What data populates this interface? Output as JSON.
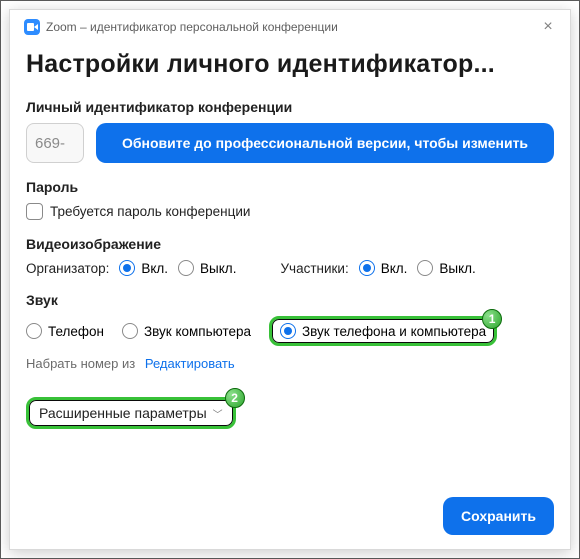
{
  "window": {
    "title": "Zoom – идентификатор персональной конференции"
  },
  "page": {
    "heading": "Настройки личного идентификатор..."
  },
  "pmi": {
    "label": "Личный идентификатор конференции",
    "value": "669-",
    "upgrade_label": "Обновите до профессиональной версии, чтобы изменить"
  },
  "password": {
    "label": "Пароль",
    "require_label": "Требуется пароль конференции",
    "checked": false
  },
  "video": {
    "label": "Видеоизображение",
    "host_label": "Организатор:",
    "participants_label": "Участники:",
    "on": "Вкл.",
    "off": "Выкл."
  },
  "audio": {
    "label": "Звук",
    "options": {
      "phone": "Телефон",
      "computer": "Звук компьютера",
      "both": "Звук телефона и компьютера"
    },
    "dial_label": "Набрать номер из",
    "edit_label": "Редактировать"
  },
  "advanced": {
    "label": "Расширенные параметры"
  },
  "footer": {
    "save": "Сохранить"
  },
  "callouts": {
    "one": "1",
    "two": "2"
  }
}
